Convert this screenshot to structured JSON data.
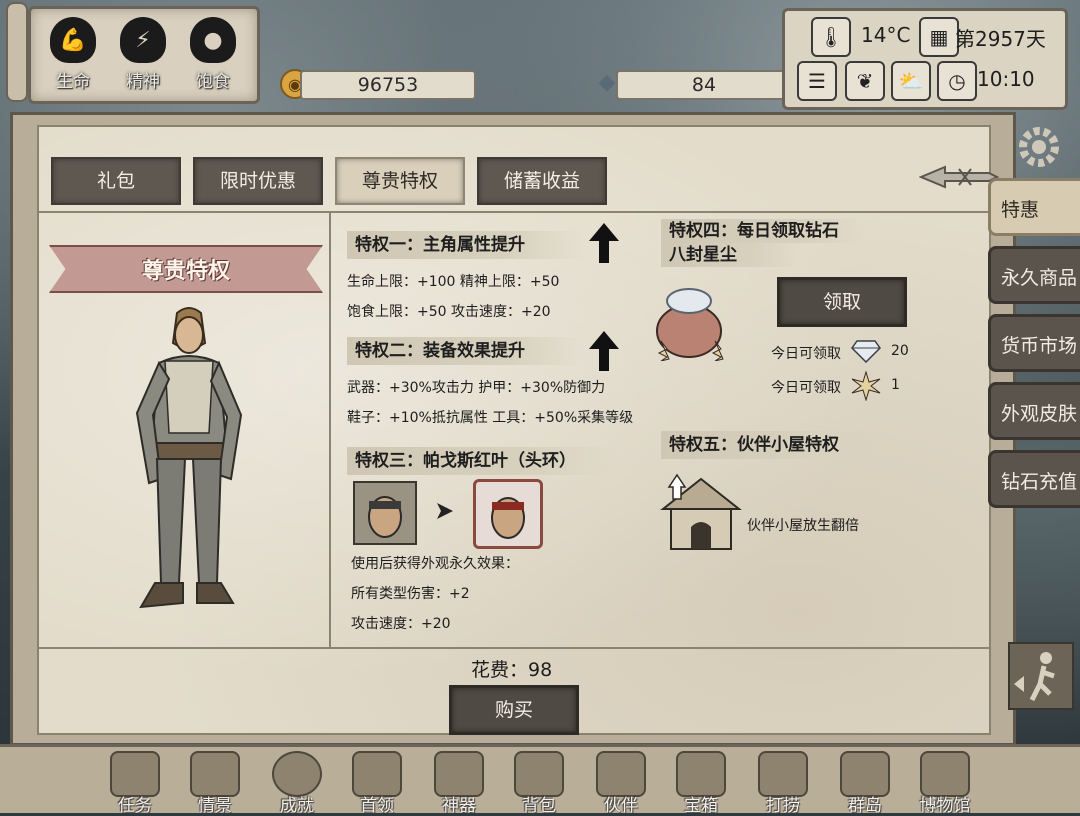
{
  "stats": [
    {
      "label": "生命",
      "icon": "muscle-icon"
    },
    {
      "label": "精神",
      "icon": "brain-icon"
    },
    {
      "label": "饱食",
      "icon": "stomach-icon"
    }
  ],
  "currency": {
    "gold": "96753",
    "diamond": "84"
  },
  "hud": {
    "temperature": "14°C",
    "day": "第2957天",
    "time": "10:10"
  },
  "tabs": [
    "礼包",
    "限时优惠",
    "尊贵特权",
    "储蓄收益"
  ],
  "active_tab": "尊贵特权",
  "banner": "尊贵特权",
  "privileges": {
    "p1": {
      "title": "特权一：主角属性提升",
      "line1": "生命上限：+100 精神上限：+50",
      "line2": "饱食上限：+50 攻击速度：+20"
    },
    "p2": {
      "title": "特权二：装备效果提升",
      "line1": "武器：+30%攻击力 护甲：+30%防御力",
      "line2": "鞋子：+10%抵抗属性 工具：+50%采集等级"
    },
    "p3": {
      "title": "特权三：帕戈斯红叶（头环）",
      "line1": "使用后获得外观永久效果：",
      "line2": "所有类型伤害：+2",
      "line3": "攻击速度：+20"
    },
    "p4": {
      "title_line1": "特权四：每日领取钻石",
      "title_line2": "八封星尘",
      "claim_button": "领取",
      "daily1_label": "今日可领取",
      "daily1_value": "20",
      "daily2_label": "今日可领取",
      "daily2_value": "1"
    },
    "p5": {
      "title": "特权五：伙伴小屋特权",
      "text": "伙伴小屋放生翻倍"
    }
  },
  "cost": {
    "label": "花费：98"
  },
  "buy_button": "购买",
  "side_tabs": [
    "特惠",
    "永久商品",
    "货币市场",
    "外观皮肤",
    "钻石充值"
  ],
  "active_side_tab": "特惠",
  "nav": [
    "任务",
    "情景",
    "成就",
    "首领",
    "神器",
    "背包",
    "伙伴",
    "宝箱",
    "打捞",
    "群岛",
    "博物馆"
  ],
  "colors": {
    "tab_dark": "#5e5850",
    "tab_active": "#d9cfbb",
    "paper": "#e3dccb",
    "ribbon": "#c39a93"
  }
}
